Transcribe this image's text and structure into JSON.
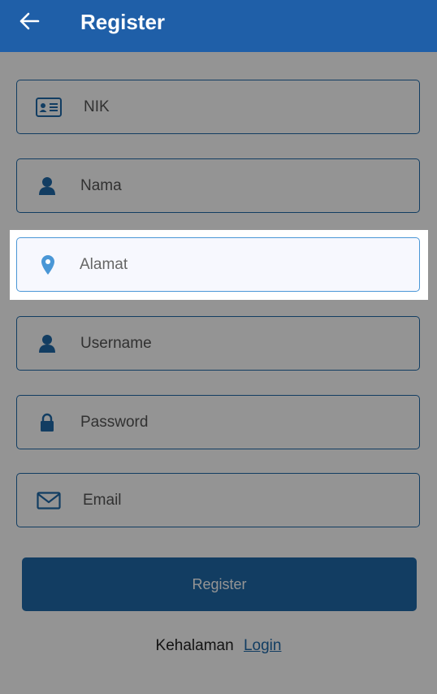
{
  "appbar": {
    "title": "Register",
    "back_icon": "arrow-left-icon"
  },
  "form": {
    "fields": [
      {
        "name": "nik",
        "placeholder": "NIK",
        "icon": "id-card-icon"
      },
      {
        "name": "nama",
        "placeholder": "Nama",
        "icon": "user-icon"
      },
      {
        "name": "alamat",
        "placeholder": "Alamat",
        "icon": "location-pin-icon"
      },
      {
        "name": "username",
        "placeholder": "Username",
        "icon": "user-icon"
      },
      {
        "name": "password",
        "placeholder": "Password",
        "icon": "lock-icon"
      },
      {
        "name": "email",
        "placeholder": "Email",
        "icon": "envelope-icon"
      }
    ],
    "submit_label": "Register"
  },
  "footer": {
    "text": "Kehalaman",
    "link_label": "Login"
  },
  "colors": {
    "appbar": "#1f5fa8",
    "primary": "#1f6aaa",
    "focus_border": "#4a97d6",
    "pin": "#4a97d6"
  }
}
